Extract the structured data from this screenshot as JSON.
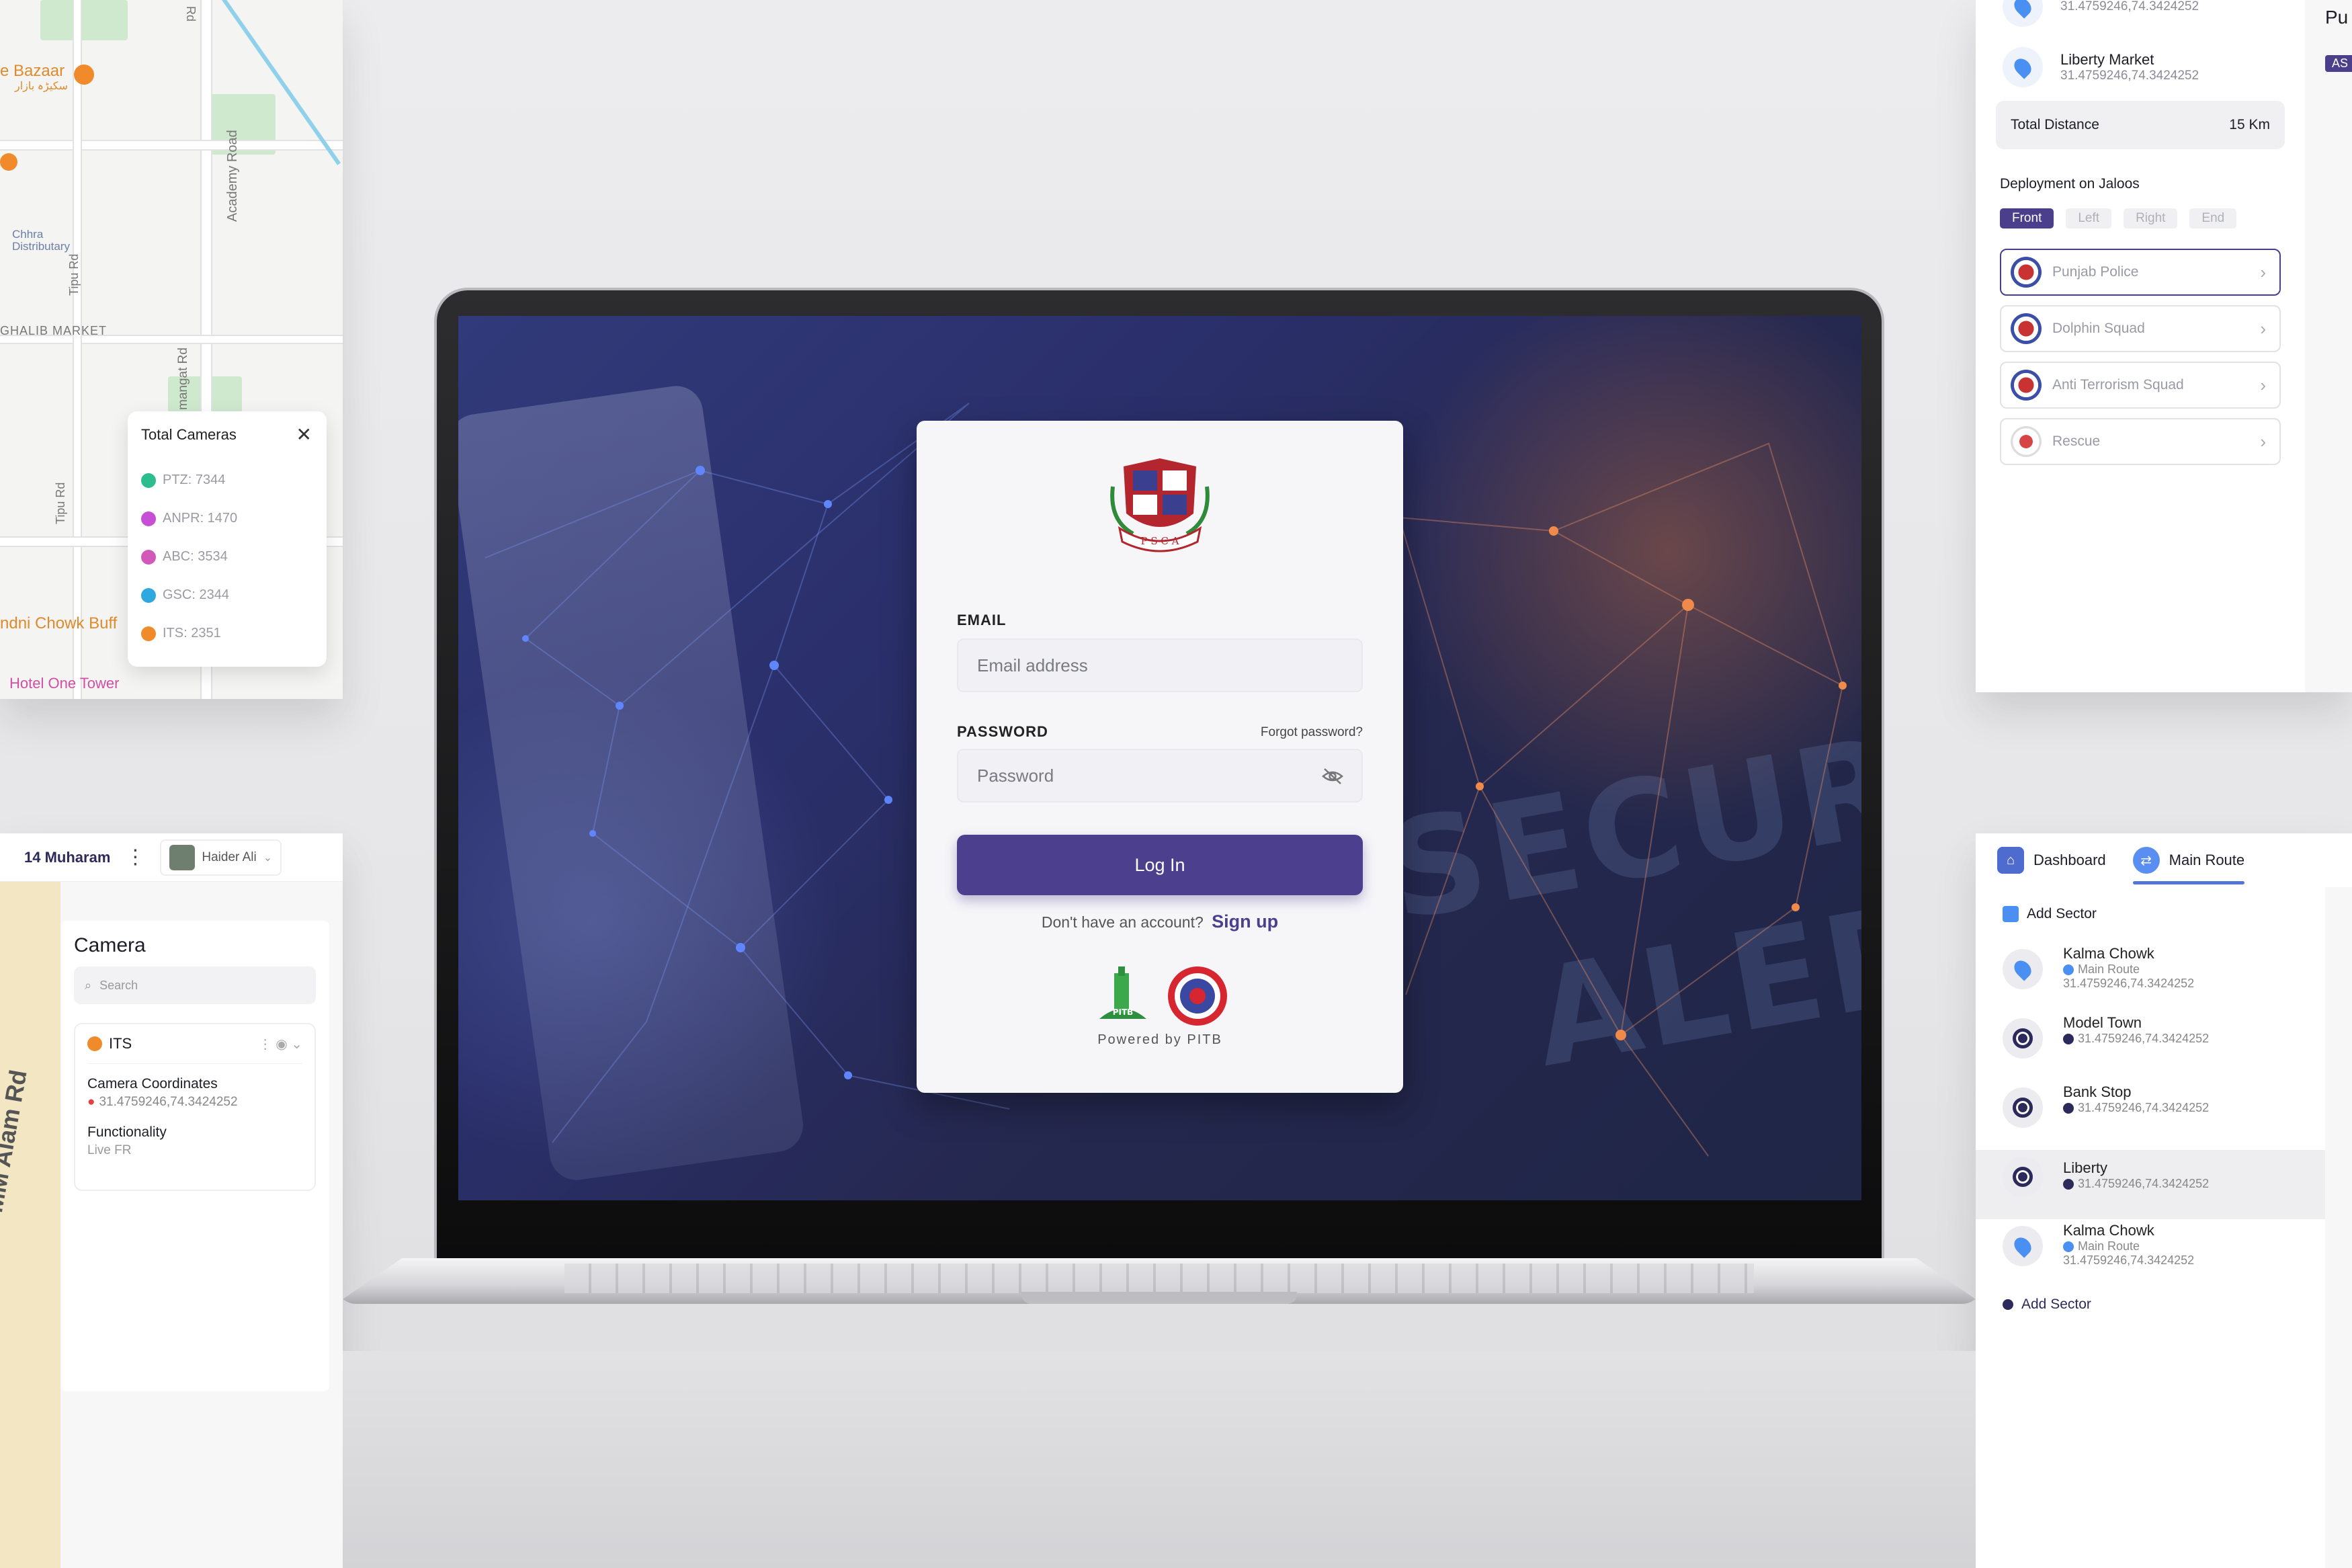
{
  "map_card": {
    "labels": {
      "bazaar": "e Bazaar",
      "bazaar_urdu": "سکیڑہ بازار",
      "chhra": "Chhra Distributary",
      "academy_road": "Academy Road",
      "tipu_rd": "Tipu Rd",
      "tipu_rd2": "Tipu Rd",
      "ghalib": "GHALIB MARKET",
      "mangat": "mangat Rd",
      "chowk": "ndni Chowk Buff",
      "hotel": "Hotel One Tower",
      "rd": "Rd"
    },
    "popup": {
      "title": "Total Cameras",
      "items": [
        {
          "label": "PTZ: 7344",
          "color": "#2bbd8e"
        },
        {
          "label": "ANPR: 1470",
          "color": "#c64fd6"
        },
        {
          "label": "ABC: 3534",
          "color": "#d259b8"
        },
        {
          "label": "GSC: 2344",
          "color": "#2fa8e0"
        },
        {
          "label": "ITS: 2351",
          "color": "#f08a2b"
        }
      ]
    }
  },
  "route_card": {
    "prev_coords": "31.4759246,74.3424252",
    "location": {
      "name": "Liberty Market",
      "coords": "31.4759246,74.3424252"
    },
    "total_distance_label": "Total Distance",
    "total_distance_value": "15 Km",
    "deployment_title": "Deployment on Jaloos",
    "chips": [
      "Front",
      "Left",
      "Right",
      "End"
    ],
    "squads": [
      "Punjab Police",
      "Dolphin Squad",
      "Anti Terrorism Squad",
      "Rescue"
    ],
    "edge_text": "Pu",
    "edge_badge": "AS"
  },
  "camera_card": {
    "event": "14 Muharam",
    "user": "Haider Ali",
    "title": "Camera",
    "search_placeholder": "Search",
    "its_label": "ITS",
    "coords_label": "Camera Coordinates",
    "coords_value": "31.4759246,74.3424252",
    "func_label": "Functionality",
    "func_value": "Live FR",
    "road_label": "MM Alam Rd"
  },
  "sector_card": {
    "tabs": [
      "Dashboard",
      "Main Route"
    ],
    "add_sector_top": "Add Sector",
    "sectors": [
      {
        "name": "Kalma Chowk",
        "route": "Main Route",
        "coords": "31.4759246,74.3424252",
        "type": "pin"
      },
      {
        "name": "Model Town",
        "coords": "31.4759246,74.3424252",
        "type": "dot"
      },
      {
        "name": "Bank Stop",
        "coords": "31.4759246,74.3424252",
        "type": "dot"
      },
      {
        "name": "Liberty",
        "coords": "31.4759246,74.3424252",
        "type": "dot"
      },
      {
        "name": "Kalma Chowk",
        "route": "Main Route",
        "coords": "31.4759246,74.3424252",
        "type": "pin"
      }
    ],
    "add_sector_bottom": "Add Sector"
  },
  "login": {
    "crest_text": "P S C A",
    "email_label": "EMAIL",
    "email_placeholder": "Email address",
    "password_label": "PASSWORD",
    "forgot": "Forgot password?",
    "password_placeholder": "Password",
    "login_button": "Log In",
    "no_account": "Don't have an account?",
    "signup": "Sign up",
    "powered": "Powered by PITB",
    "pitb_text": "PITB"
  },
  "background": {
    "word1": "SECURI",
    "word2": "ALER"
  },
  "colors": {
    "primary": "#4c3f8d",
    "accent": "#4a8ff2"
  }
}
